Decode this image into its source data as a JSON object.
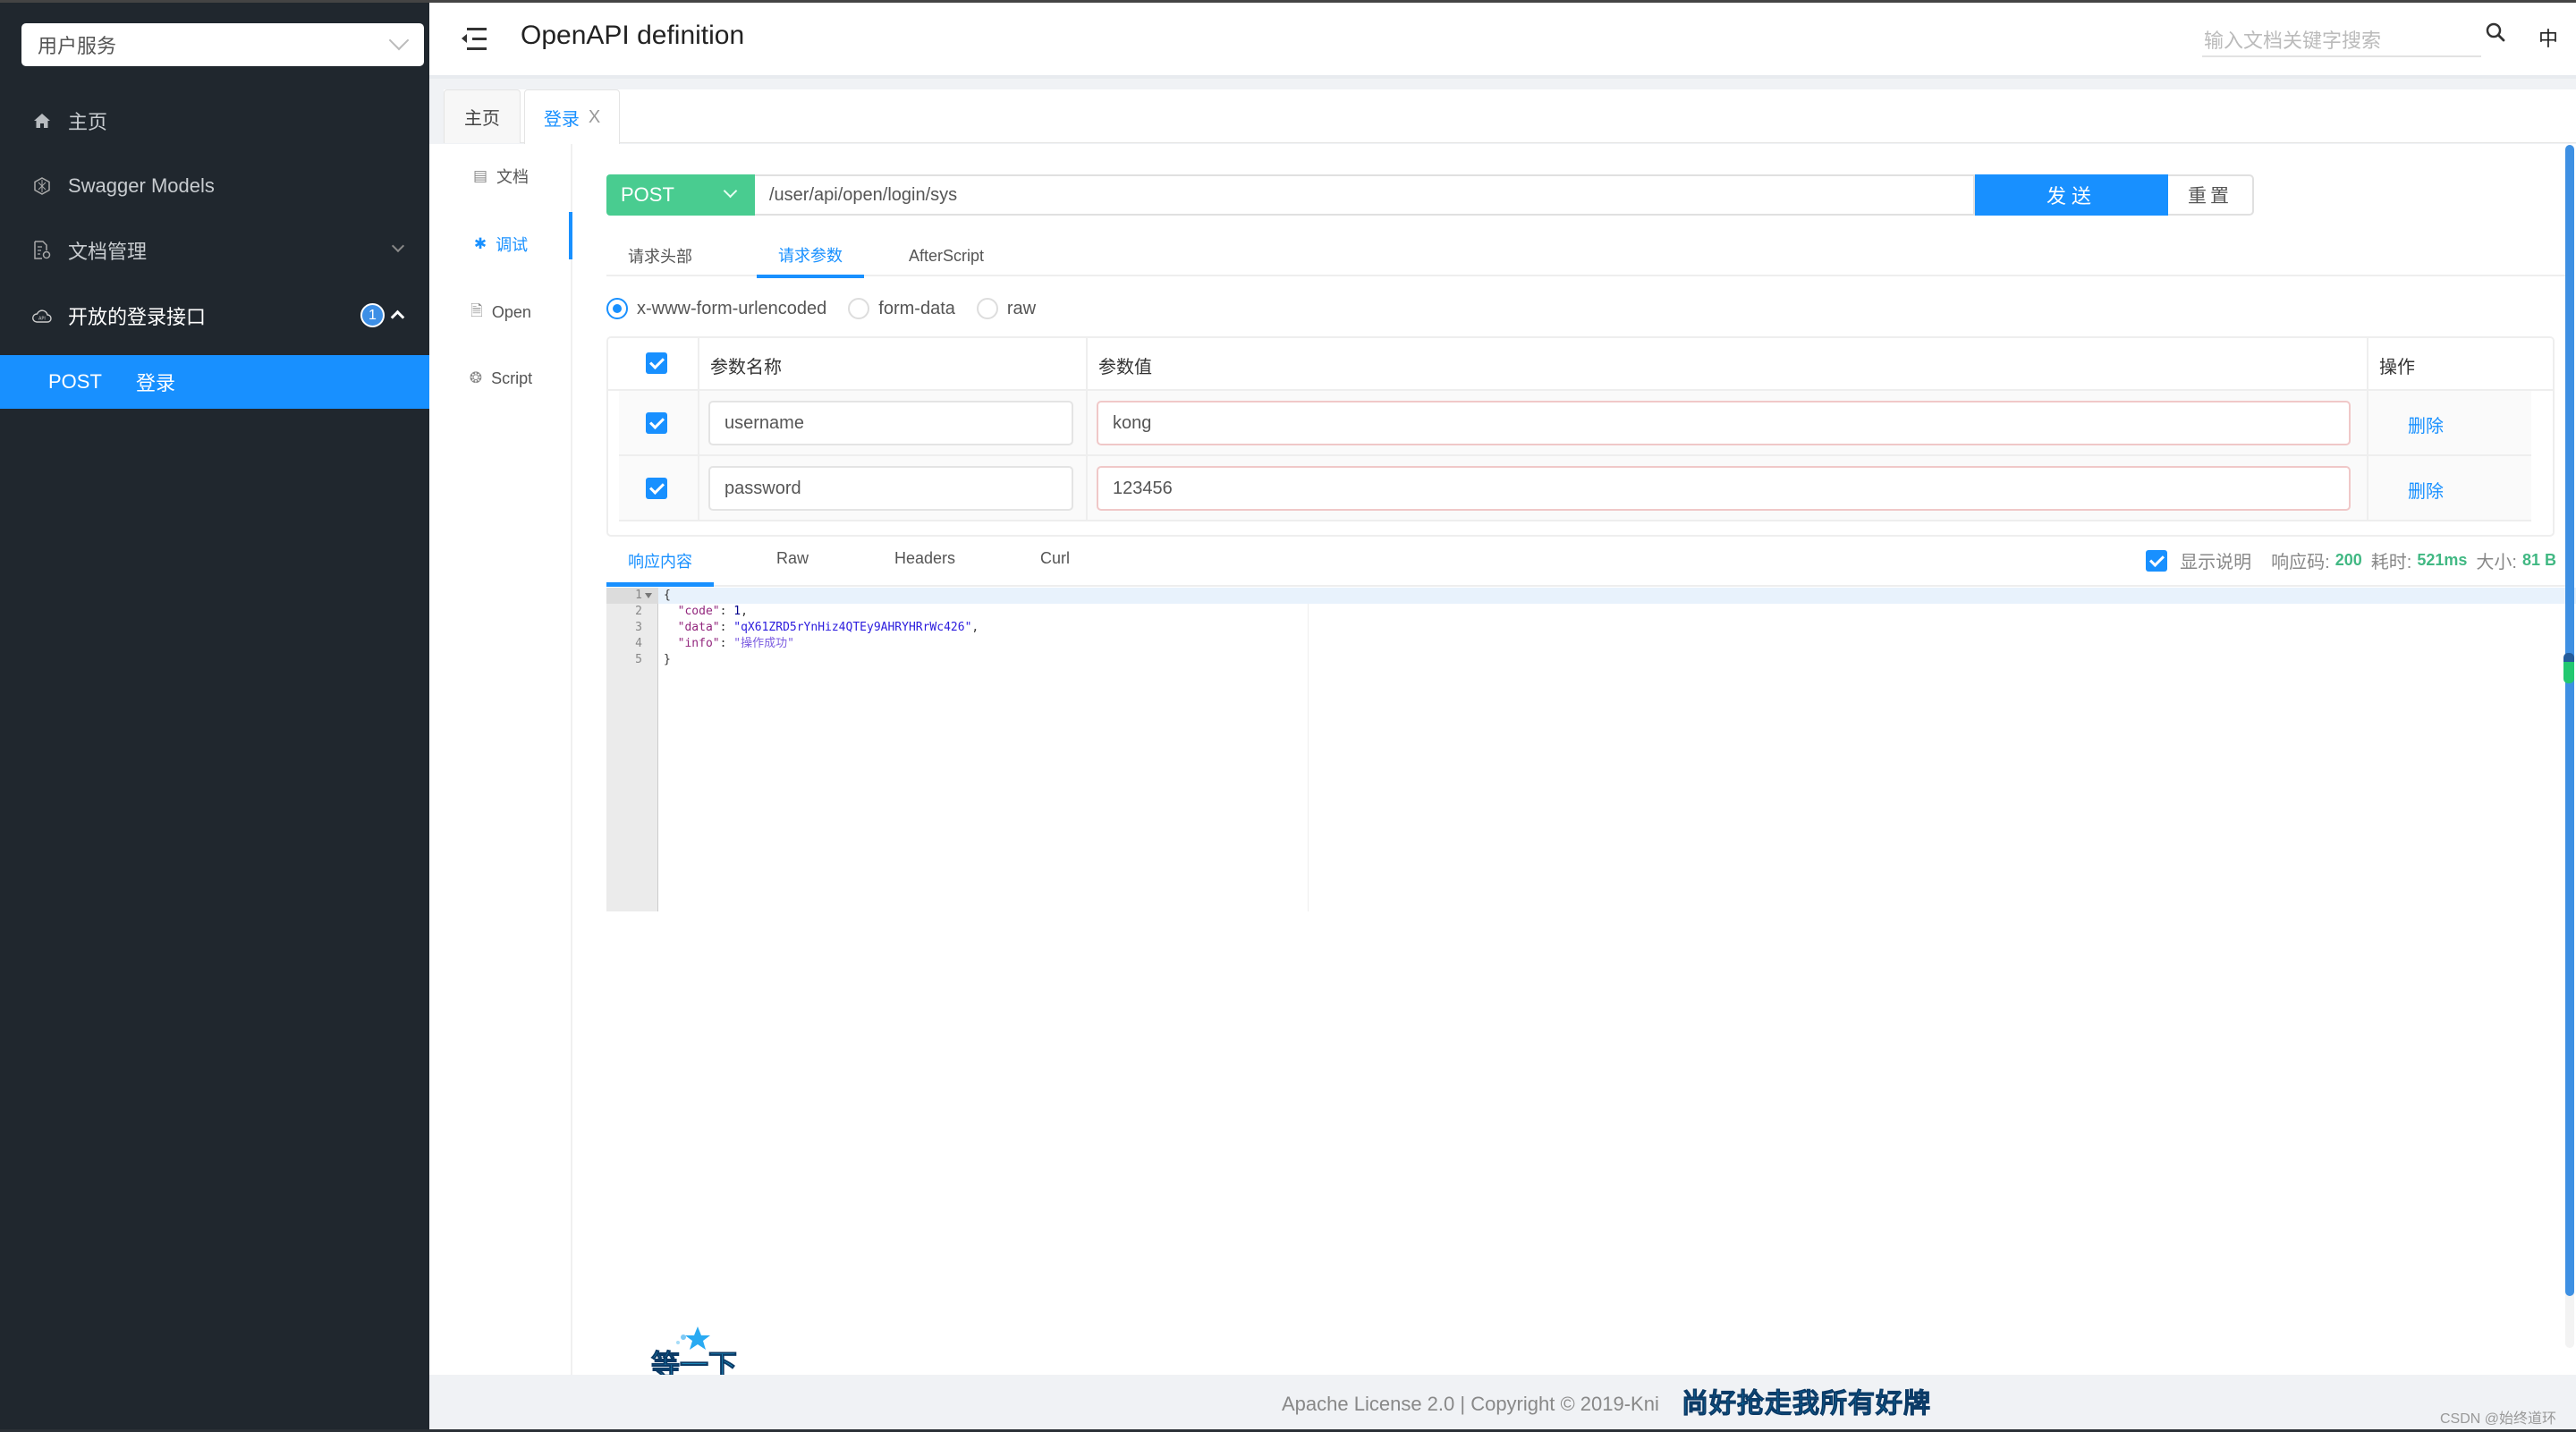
{
  "sidebar": {
    "service_select": "用户服务",
    "items": [
      {
        "label": "主页",
        "icon": "home-icon"
      },
      {
        "label": "Swagger Models",
        "icon": "cube-icon"
      },
      {
        "label": "文档管理",
        "icon": "doc-settings-icon"
      },
      {
        "label": "开放的登录接口",
        "icon": "cloud-api-icon",
        "badge": "1"
      }
    ],
    "active_sub": {
      "method": "POST",
      "label": "登录"
    }
  },
  "header": {
    "title": "OpenAPI definition",
    "search_placeholder": "输入文档关键字搜索",
    "lang": "中"
  },
  "tabs": [
    {
      "label": "主页"
    },
    {
      "label": "登录",
      "close": "X"
    }
  ],
  "vnav": [
    {
      "label": "文档",
      "icon": "document-icon"
    },
    {
      "label": "调试",
      "icon": "bug-icon"
    },
    {
      "label": "Open",
      "icon": "file-icon"
    },
    {
      "label": "Script",
      "icon": "script-icon"
    }
  ],
  "request": {
    "method": "POST",
    "url": "/user/api/open/login/sys",
    "send_label": "发送",
    "reset_label": "重置",
    "subtabs": [
      "请求头部",
      "请求参数",
      "AfterScript"
    ],
    "content_types": [
      "x-www-form-urlencoded",
      "form-data",
      "raw"
    ],
    "columns": [
      "参数名称",
      "参数值",
      "操作"
    ],
    "params": [
      {
        "name": "username",
        "value": "kong",
        "action": "删除"
      },
      {
        "name": "password",
        "value": "123456",
        "action": "删除"
      }
    ]
  },
  "response": {
    "tabs": [
      "响应内容",
      "Raw",
      "Headers",
      "Curl"
    ],
    "show_desc": "显示说明",
    "code_label": "响应码:",
    "code": "200",
    "time_label": "耗时:",
    "time": "521ms",
    "size_label": "大小:",
    "size": "81 B",
    "lines": [
      "1",
      "2",
      "3",
      "4",
      "5"
    ],
    "json": {
      "code": "1",
      "data": "qX61ZRD5rYnHiz4QTEy9AHRYHRrWc426",
      "info": "操作成功"
    }
  },
  "overlay": {
    "wait": "等一下",
    "caption": "尚好抢走我所有好牌"
  },
  "footer": {
    "text": "Apache License 2.0 | Copyright © 2019-Kni",
    "watermark": "CSDN @始终道环"
  }
}
